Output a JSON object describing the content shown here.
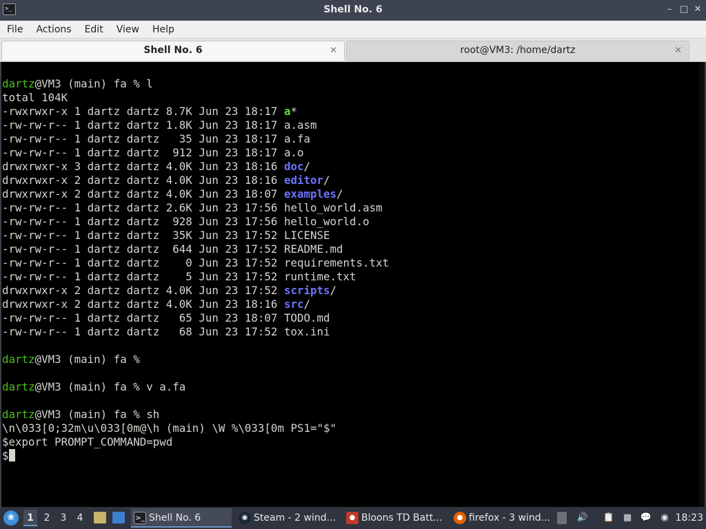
{
  "window": {
    "title": "Shell No. 6",
    "app_icon_glyph": ">_",
    "controls": {
      "minimize": "–",
      "maximize": "□",
      "close": "✕"
    }
  },
  "menubar": {
    "items": [
      {
        "label": "File"
      },
      {
        "label": "Actions"
      },
      {
        "label": "Edit"
      },
      {
        "label": "View"
      },
      {
        "label": "Help"
      }
    ]
  },
  "tabs": [
    {
      "label": "Shell No. 6",
      "active": true,
      "close": "✕"
    },
    {
      "label": "root@VM3: /home/dartz",
      "active": false,
      "close": "✕"
    }
  ],
  "terminal": {
    "colors": {
      "background": "#000000",
      "text": "#d3d7cf",
      "user": "#4cc21a",
      "executable": "#5ee02c",
      "directory": "#6b74ff"
    },
    "lines": [
      {
        "segments": [
          {
            "t": "dartz",
            "c": "green"
          },
          {
            "t": "@VM3 (main) fa % l"
          }
        ]
      },
      {
        "segments": [
          {
            "t": "total 104K"
          }
        ]
      },
      {
        "segments": [
          {
            "t": "-rwxrwxr-x 1 dartz dartz 8.7K Jun 23 18:17 "
          },
          {
            "t": "a",
            "c": "exec"
          },
          {
            "t": "*"
          }
        ]
      },
      {
        "segments": [
          {
            "t": "-rw-rw-r-- 1 dartz dartz 1.8K Jun 23 18:17 a.asm"
          }
        ]
      },
      {
        "segments": [
          {
            "t": "-rw-rw-r-- 1 dartz dartz   35 Jun 23 18:17 a.fa"
          }
        ]
      },
      {
        "segments": [
          {
            "t": "-rw-rw-r-- 1 dartz dartz  912 Jun 23 18:17 a.o"
          }
        ]
      },
      {
        "segments": [
          {
            "t": "drwxrwxr-x 3 dartz dartz 4.0K Jun 23 18:16 "
          },
          {
            "t": "doc",
            "c": "dir"
          },
          {
            "t": "/"
          }
        ]
      },
      {
        "segments": [
          {
            "t": "drwxrwxr-x 2 dartz dartz 4.0K Jun 23 18:16 "
          },
          {
            "t": "editor",
            "c": "dir"
          },
          {
            "t": "/"
          }
        ]
      },
      {
        "segments": [
          {
            "t": "drwxrwxr-x 2 dartz dartz 4.0K Jun 23 18:07 "
          },
          {
            "t": "examples",
            "c": "dir"
          },
          {
            "t": "/"
          }
        ]
      },
      {
        "segments": [
          {
            "t": "-rw-rw-r-- 1 dartz dartz 2.6K Jun 23 17:56 hello_world.asm"
          }
        ]
      },
      {
        "segments": [
          {
            "t": "-rw-rw-r-- 1 dartz dartz  928 Jun 23 17:56 hello_world.o"
          }
        ]
      },
      {
        "segments": [
          {
            "t": "-rw-rw-r-- 1 dartz dartz  35K Jun 23 17:52 LICENSE"
          }
        ]
      },
      {
        "segments": [
          {
            "t": "-rw-rw-r-- 1 dartz dartz  644 Jun 23 17:52 README.md"
          }
        ]
      },
      {
        "segments": [
          {
            "t": "-rw-rw-r-- 1 dartz dartz    0 Jun 23 17:52 requirements.txt"
          }
        ]
      },
      {
        "segments": [
          {
            "t": "-rw-rw-r-- 1 dartz dartz    5 Jun 23 17:52 runtime.txt"
          }
        ]
      },
      {
        "segments": [
          {
            "t": "drwxrwxr-x 2 dartz dartz 4.0K Jun 23 17:52 "
          },
          {
            "t": "scripts",
            "c": "dir"
          },
          {
            "t": "/"
          }
        ]
      },
      {
        "segments": [
          {
            "t": "drwxrwxr-x 2 dartz dartz 4.0K Jun 23 18:16 "
          },
          {
            "t": "src",
            "c": "dir"
          },
          {
            "t": "/"
          }
        ]
      },
      {
        "segments": [
          {
            "t": "-rw-rw-r-- 1 dartz dartz   65 Jun 23 18:07 TODO.md"
          }
        ]
      },
      {
        "segments": [
          {
            "t": "-rw-rw-r-- 1 dartz dartz   68 Jun 23 17:52 tox.ini"
          }
        ]
      },
      {
        "segments": []
      },
      {
        "segments": [
          {
            "t": "dartz",
            "c": "green"
          },
          {
            "t": "@VM3 (main) fa %"
          }
        ]
      },
      {
        "segments": []
      },
      {
        "segments": [
          {
            "t": "dartz",
            "c": "green"
          },
          {
            "t": "@VM3 (main) fa % v a.fa"
          }
        ]
      },
      {
        "segments": []
      },
      {
        "segments": [
          {
            "t": "dartz",
            "c": "green"
          },
          {
            "t": "@VM3 (main) fa % sh"
          }
        ]
      },
      {
        "segments": [
          {
            "t": "\\n\\033[0;32m\\u\\033[0m@\\h (main) \\W %\\033[0m PS1=\"$\""
          }
        ]
      },
      {
        "segments": [
          {
            "t": "$export PROMPT_COMMAND=pwd"
          }
        ]
      },
      {
        "segments": [
          {
            "t": "$"
          }
        ],
        "cursor": true
      }
    ]
  },
  "taskbar": {
    "start_icon": "start-menu-icon",
    "workspaces": [
      {
        "label": "1",
        "active": true
      },
      {
        "label": "2",
        "active": false
      },
      {
        "label": "3",
        "active": false
      },
      {
        "label": "4",
        "active": false
      }
    ],
    "tasks": [
      {
        "label": "Shell No. 6",
        "icon": "terminal-icon",
        "active": true
      },
      {
        "label": "Steam - 2 wind...",
        "icon": "steam-icon",
        "active": false
      },
      {
        "label": "Bloons TD Batt...",
        "icon": "bloons-icon",
        "active": false
      },
      {
        "label": "firefox - 3 wind...",
        "icon": "firefox-icon",
        "active": false
      }
    ],
    "clock": "18:23"
  }
}
